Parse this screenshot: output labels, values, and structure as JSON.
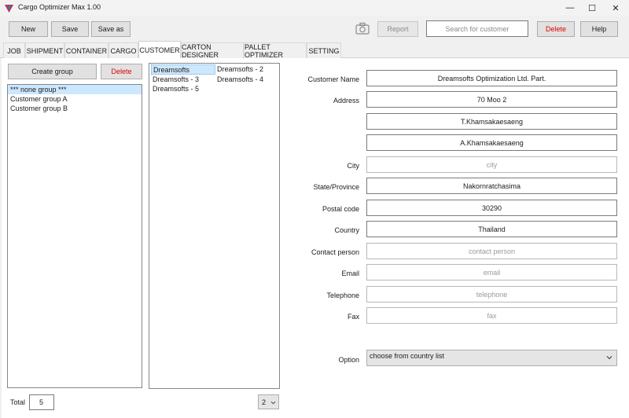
{
  "window": {
    "title": "Cargo Optimizer Max 1.00",
    "minimize_glyph": "—",
    "maximize_glyph": "☐",
    "close_glyph": "✕"
  },
  "toolbar": {
    "new_label": "New",
    "save_label": "Save",
    "save_as_label": "Save as",
    "report_label": "Report",
    "search_placeholder": "Search for customer",
    "delete_label": "Delete",
    "help_label": "Help",
    "camera_icon": "camera-icon"
  },
  "tabs": [
    {
      "label": "JOB"
    },
    {
      "label": "SHIPMENT"
    },
    {
      "label": "CONTAINER"
    },
    {
      "label": "CARGO"
    },
    {
      "label": "CUSTOMER",
      "active": true
    },
    {
      "label": "CARTON DESIGNER"
    },
    {
      "label": "PALLET OPTIMIZER"
    },
    {
      "label": "SETTING"
    }
  ],
  "groups": {
    "create_label": "Create group",
    "delete_label": "Delete",
    "items": [
      "*** none group ***",
      "Customer group A",
      "Customer group B"
    ],
    "selected_index": 0,
    "total_label": "Total",
    "total_value": "5"
  },
  "customers": {
    "items": [
      "Dreamsofts",
      "Dreamsofts - 2",
      "Dreamsofts - 3",
      "Dreamsofts - 4",
      "Dreamsofts - 5"
    ],
    "selected_index": 0,
    "page_value": "2"
  },
  "form": {
    "customer_name": {
      "label": "Customer Name",
      "value": "Dreamsofts Optimization Ltd. Part."
    },
    "address": {
      "label": "Address",
      "line1": "70 Moo 2",
      "line2": "T.Khamsakaesaeng",
      "line3": "A.Khamsakaesaeng"
    },
    "city": {
      "label": "City",
      "placeholder": "city"
    },
    "state": {
      "label": "State/Province",
      "value": "Nakornratchasima"
    },
    "postal": {
      "label": "Postal code",
      "value": "30290"
    },
    "country": {
      "label": "Country",
      "value": "Thailand"
    },
    "contact": {
      "label": "Contact person",
      "placeholder": "contact person"
    },
    "email": {
      "label": "Email",
      "placeholder": "email"
    },
    "telephone": {
      "label": "Telephone",
      "placeholder": "telephone"
    },
    "fax": {
      "label": "Fax",
      "placeholder": "fax"
    },
    "option": {
      "label": "Option",
      "value": "choose from country list"
    }
  },
  "colors": {
    "accent_red": "#e00000",
    "selection": "#cce8ff",
    "active_tab": "#ffffff"
  }
}
